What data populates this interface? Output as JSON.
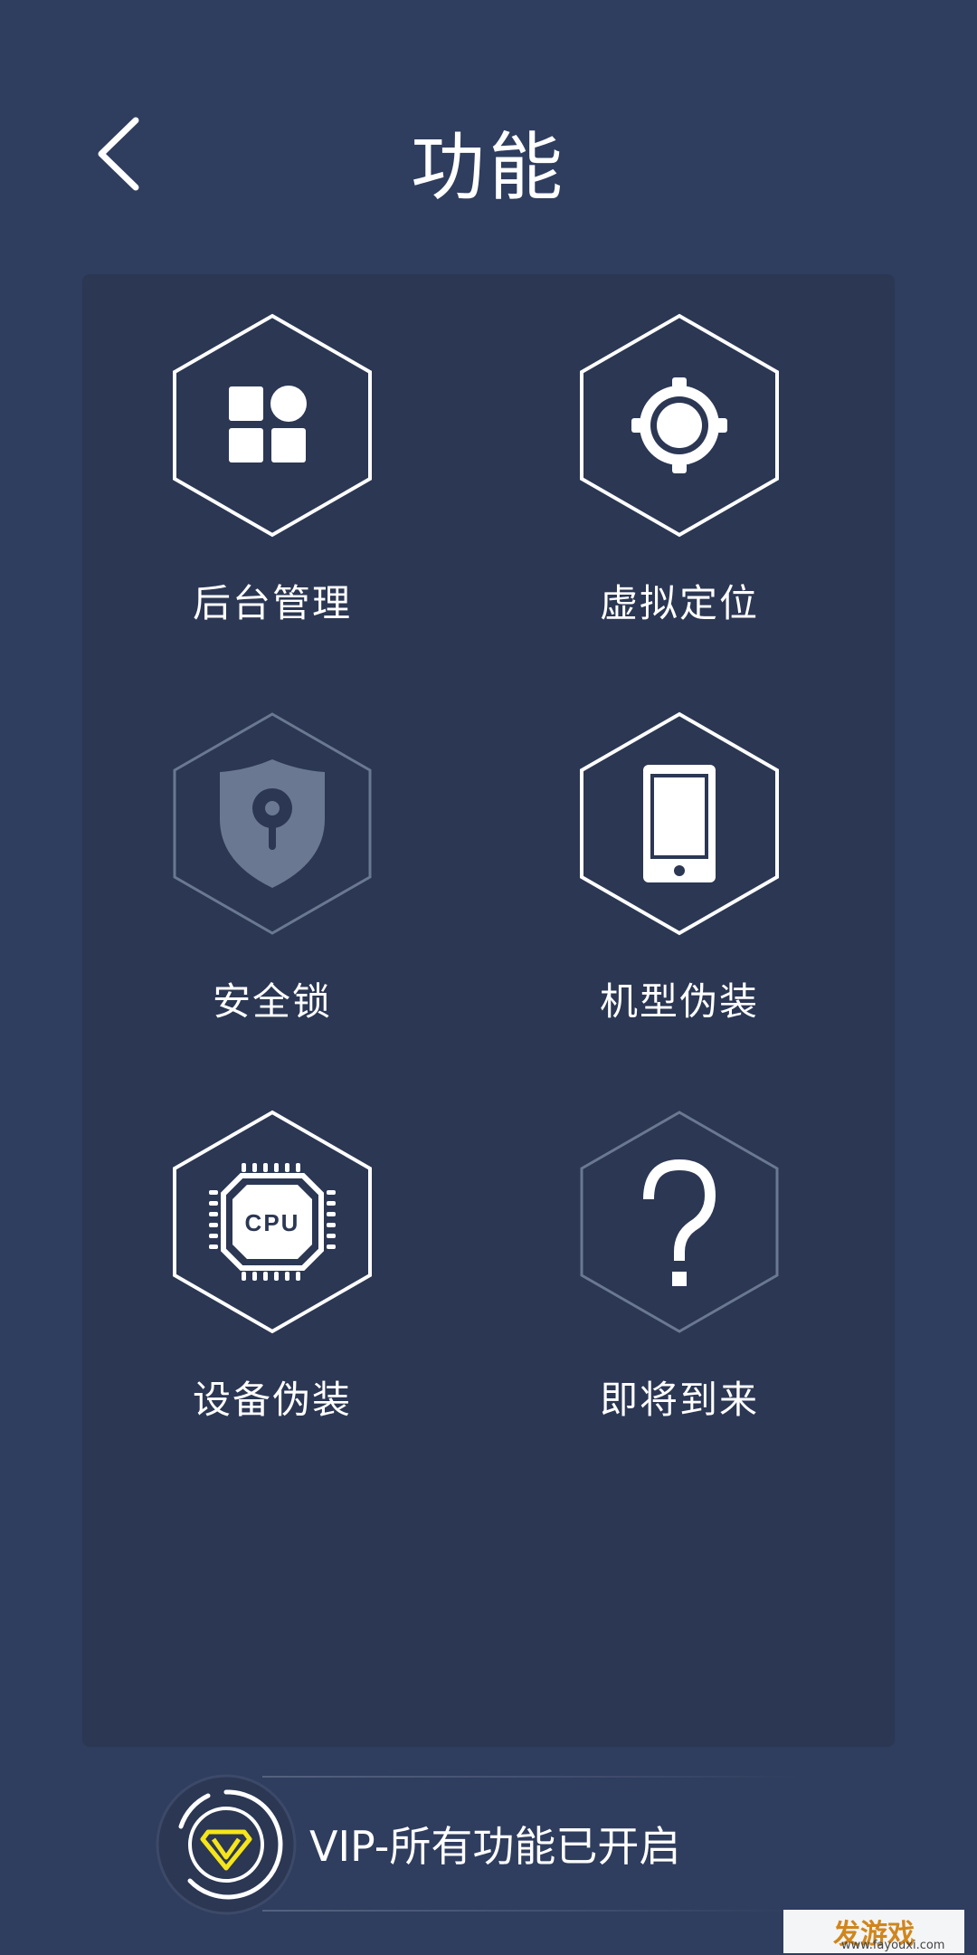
{
  "header": {
    "title": "功能",
    "back_icon": "chevron-left-icon"
  },
  "features": [
    {
      "label": "后台管理",
      "icon": "apps-grid-icon",
      "enabled": true
    },
    {
      "label": "虚拟定位",
      "icon": "location-target-icon",
      "enabled": true
    },
    {
      "label": "安全锁",
      "icon": "shield-lock-icon",
      "enabled": false
    },
    {
      "label": "机型伪装",
      "icon": "phone-icon",
      "enabled": true
    },
    {
      "label": "设备伪装",
      "icon": "cpu-chip-icon",
      "enabled": true
    },
    {
      "label": "即将到来",
      "icon": "question-mark-icon",
      "enabled": false
    }
  ],
  "cpu_text": "CPU",
  "vip": {
    "text": "VIP-所有功能已开启",
    "icon": "vip-badge-icon"
  },
  "watermark": {
    "text": "发游戏",
    "sub": "www.fayouxi.com"
  },
  "colors": {
    "background": "#2f3d5e",
    "panel": "#2b3753",
    "active_icon": "#ffffff",
    "disabled_icon": "#6b7891",
    "vip_accent": "#f5e51a"
  }
}
